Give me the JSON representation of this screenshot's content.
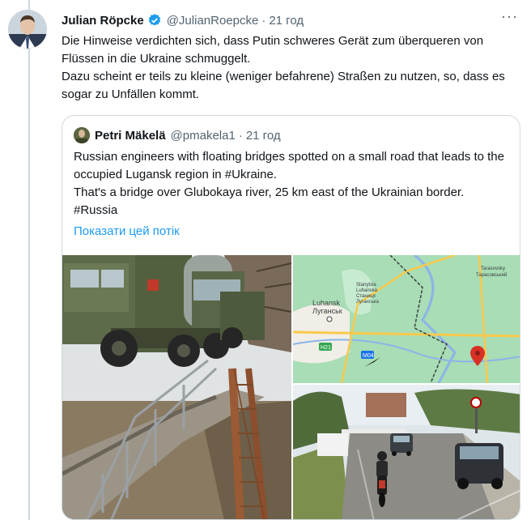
{
  "tweet": {
    "author_name": "Julian Röpcke",
    "handle": "@JulianRoepcke",
    "separator": "·",
    "time": "21 год",
    "more": "···",
    "lines": [
      "Die Hinweise verdichten sich, dass Putin schweres Gerät zum überqueren von Flüssen in die Ukraine schmuggelt.",
      "Dazu scheint er teils zu kleine (weniger befahrene) Straßen zu nutzen, so, dass es sogar zu Unfällen kommt."
    ]
  },
  "quote": {
    "author_name": "Petri Mäkelä",
    "handle": "@pmakela1",
    "separator": "·",
    "time": "21 год",
    "lines": [
      "Russian engineers with floating bridges spotted on a small road that leads to the occupied Lugansk region in #Ukraine.",
      "That's a bridge over Glubokaya river, 25 km east of the Ukrainian border. #Russia"
    ],
    "show_thread": "Показати цей потік"
  },
  "map": {
    "labels": {
      "luhansk_en": "Luhansk",
      "luhansk_ru": "Луганськ",
      "stanytsia_1": "Stanytsia",
      "stanytsia_2": "Luhanska",
      "stanytsia_3": "Станиця",
      "stanytsia_4": "Луганська",
      "tarasovsky_en": "Tarasovsky",
      "tarasovsky_ru": "Тарасовський",
      "road_1": "M04",
      "road_2": "H21"
    },
    "colors": {
      "land": "#a8ddb5",
      "urban": "#f0eee6",
      "road": "#f9c94c",
      "water": "#8ab4e8",
      "border": "#3c4043",
      "pin": "#d93025"
    }
  },
  "colors": {
    "link": "#1d9bf0",
    "text": "#0f1419",
    "secondary": "#536471",
    "border": "#cfd9de"
  }
}
